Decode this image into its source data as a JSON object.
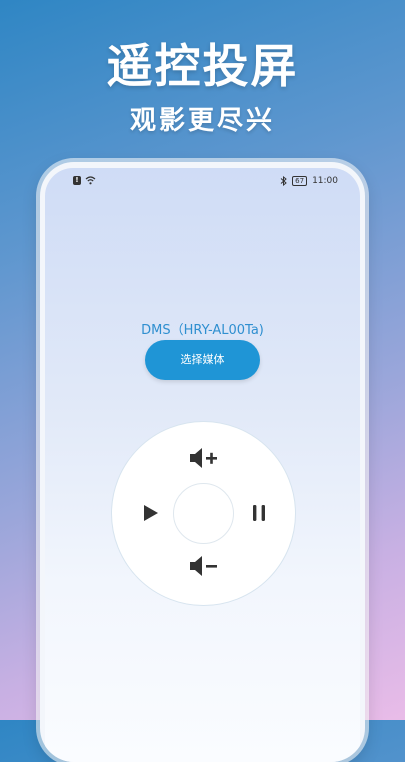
{
  "promo": {
    "title": "遥控投屏",
    "subtitle": "观影更尽兴"
  },
  "statusbar": {
    "battery": "67",
    "time": "11:00",
    "icons": [
      "alert-icon",
      "wifi-icon",
      "bluetooth-icon",
      "battery-icon"
    ]
  },
  "device": {
    "name": "DMS（HRY-AL00Ta)"
  },
  "actions": {
    "select_media_label": "选择媒体"
  },
  "remote": {
    "controls": [
      "volume-up-icon",
      "play-icon",
      "pause-icon",
      "volume-down-icon"
    ]
  },
  "colors": {
    "accent": "#1f95d6",
    "device_name": "#2f8fd0",
    "icon": "#333333"
  }
}
